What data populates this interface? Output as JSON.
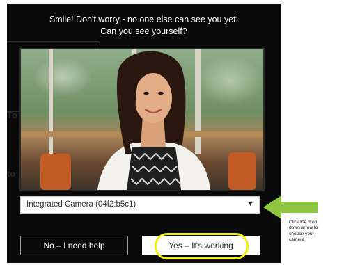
{
  "dialog": {
    "title_line1": "Smile! Don't worry - no one else can see you yet!",
    "title_line2": "Can you see yourself?"
  },
  "camera_select": {
    "selected": "Integrated Camera (04f2:b5c1)",
    "caret_icon": "dropdown-caret-icon"
  },
  "buttons": {
    "help_label": "No – I need help",
    "working_label": "Yes – It's working"
  },
  "annotation": {
    "note_lines": [
      "Click the drop",
      "down arrow to",
      "choose your",
      "camera"
    ],
    "arrow_color": "#8ec63f",
    "highlight_color": "#f2f20a"
  }
}
